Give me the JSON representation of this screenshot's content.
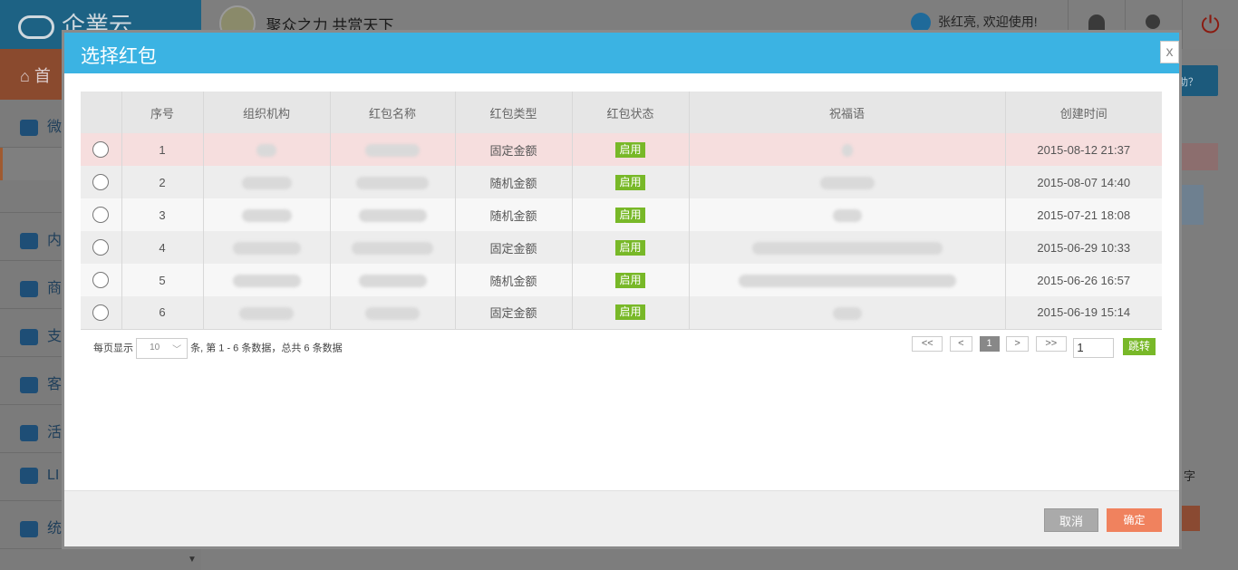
{
  "background": {
    "logo_text": "企業云",
    "slogan": "聚众之力 共赏天下",
    "user_greeting": "张红亮, 欢迎使用!",
    "home_label": "首",
    "sidebar_items": [
      "微",
      "内",
      "商",
      "支",
      "客",
      "活",
      "LI",
      "统"
    ],
    "help_button": "助？",
    "side_text": "字"
  },
  "modal": {
    "title": "选择红包",
    "close_label": "x",
    "table": {
      "columns": [
        "",
        "序号",
        "组织机构",
        "红包名称",
        "红包类型",
        "红包状态",
        "祝福语",
        "创建时间"
      ],
      "rows": [
        {
          "seq": "1",
          "type": "固定金额",
          "status": "启用",
          "created": "2015-08-12 21:37"
        },
        {
          "seq": "2",
          "type": "随机金额",
          "status": "启用",
          "created": "2015-08-07 14:40"
        },
        {
          "seq": "3",
          "type": "随机金额",
          "status": "启用",
          "created": "2015-07-21 18:08"
        },
        {
          "seq": "4",
          "type": "固定金额",
          "status": "启用",
          "created": "2015-06-29 10:33"
        },
        {
          "seq": "5",
          "type": "随机金额",
          "status": "启用",
          "created": "2015-06-26 16:57"
        },
        {
          "seq": "6",
          "type": "固定金额",
          "status": "启用",
          "created": "2015-06-19 15:14"
        }
      ]
    },
    "pagination": {
      "per_page_prefix": "每页显示",
      "per_page_value": "10",
      "summary": "条, 第 1 - 6 条数据，总共 6 条数据",
      "first": "<<",
      "prev": "<",
      "current_page": "1",
      "next": ">",
      "last": ">>",
      "jump_value": "1",
      "jump_label": "跳转"
    },
    "cancel_label": "取消",
    "confirm_label": "确定"
  }
}
